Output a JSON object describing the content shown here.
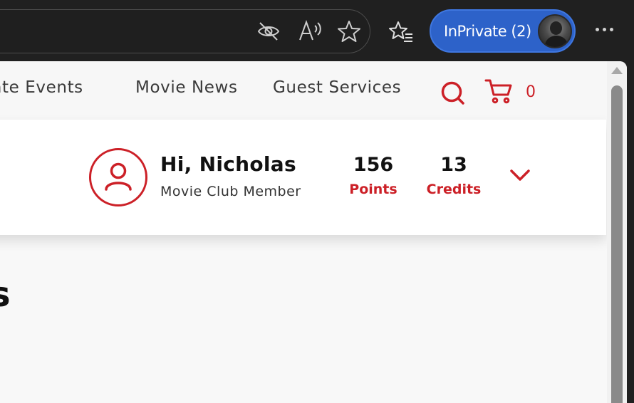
{
  "browser": {
    "inprivate_label": "InPrivate (2)",
    "icons": [
      "tracking-hidden-icon",
      "read-aloud-icon",
      "favorite-star-icon",
      "favorites-list-icon",
      "more-icon"
    ]
  },
  "nav": {
    "items": [
      {
        "label": "Private Events"
      },
      {
        "label": "Movie News"
      },
      {
        "label": "Guest Services"
      }
    ],
    "cart_count": "0"
  },
  "account": {
    "greeting": "Hi, Nicholas",
    "membership": "Movie Club Member",
    "points_value": "156",
    "points_label": "Points",
    "credits_value": "13",
    "credits_label": "Credits"
  },
  "content": {
    "heading_fragment": "s"
  },
  "colors": {
    "brand_red": "#cc2027",
    "inprivate_blue": "#2d62c9",
    "chrome_bg": "#202020"
  }
}
